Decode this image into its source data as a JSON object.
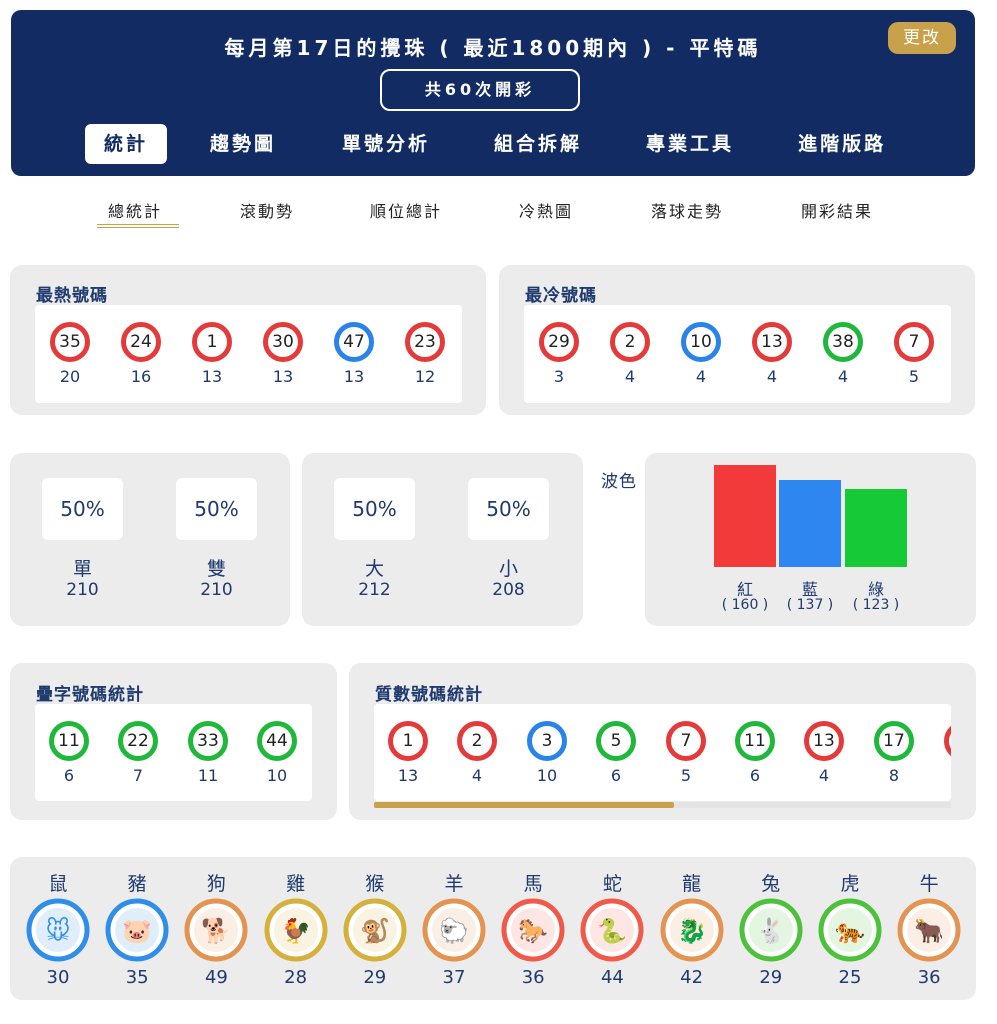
{
  "header": {
    "title": "每月第17日的攪珠 ( 最近1800期內 ) - 平特碼",
    "change_label": "更改",
    "draw_count": "共60次開彩",
    "tabs": [
      "統計",
      "趨勢圖",
      "單號分析",
      "組合拆解",
      "專業工具",
      "進階版路"
    ],
    "active_tab": "統計"
  },
  "sub_tabs": [
    "總統計",
    "滾動勢",
    "順位總計",
    "冷熱圖",
    "落球走勢",
    "開彩結果"
  ],
  "hot": {
    "title": "最熱號碼",
    "balls": [
      {
        "num": "35",
        "color": "red",
        "count": "20"
      },
      {
        "num": "24",
        "color": "red",
        "count": "16"
      },
      {
        "num": "1",
        "color": "red",
        "count": "13"
      },
      {
        "num": "30",
        "color": "red",
        "count": "13"
      },
      {
        "num": "47",
        "color": "blue",
        "count": "13"
      },
      {
        "num": "23",
        "color": "red",
        "count": "12"
      }
    ]
  },
  "cold": {
    "title": "最冷號碼",
    "balls": [
      {
        "num": "29",
        "color": "red",
        "count": "3"
      },
      {
        "num": "2",
        "color": "red",
        "count": "4"
      },
      {
        "num": "10",
        "color": "blue",
        "count": "4"
      },
      {
        "num": "13",
        "color": "red",
        "count": "4"
      },
      {
        "num": "38",
        "color": "green",
        "count": "4"
      },
      {
        "num": "7",
        "color": "red",
        "count": "5"
      }
    ]
  },
  "odd_even": {
    "odd": {
      "pct": "50%",
      "label": "單",
      "count": "210"
    },
    "even": {
      "pct": "50%",
      "label": "雙",
      "count": "210"
    }
  },
  "big_small": {
    "big": {
      "pct": "50%",
      "label": "大",
      "count": "212"
    },
    "small": {
      "pct": "50%",
      "label": "小",
      "count": "208"
    }
  },
  "wave": {
    "title": "波色",
    "colors": {
      "red": "#f23a3a",
      "blue": "#2e86f0",
      "green": "#16c936"
    }
  },
  "chart_data": {
    "type": "bar",
    "categories": [
      "紅",
      "藍",
      "綠"
    ],
    "values": [
      160,
      137,
      123
    ],
    "value_labels": [
      "( 160 )",
      "( 137 )",
      "( 123 )"
    ],
    "colors": [
      "#f23a3a",
      "#2e86f0",
      "#16c936"
    ]
  },
  "repeat": {
    "title": "疊字號碼統計",
    "balls": [
      {
        "num": "11",
        "color": "green",
        "count": "6"
      },
      {
        "num": "22",
        "color": "green",
        "count": "7"
      },
      {
        "num": "33",
        "color": "green",
        "count": "11"
      },
      {
        "num": "44",
        "color": "green",
        "count": "10"
      }
    ]
  },
  "prime": {
    "title": "質數號碼統計",
    "balls": [
      {
        "num": "1",
        "color": "red",
        "count": "13"
      },
      {
        "num": "2",
        "color": "red",
        "count": "4"
      },
      {
        "num": "3",
        "color": "blue",
        "count": "10"
      },
      {
        "num": "5",
        "color": "green",
        "count": "6"
      },
      {
        "num": "7",
        "color": "red",
        "count": "5"
      },
      {
        "num": "11",
        "color": "green",
        "count": "6"
      },
      {
        "num": "13",
        "color": "red",
        "count": "4"
      },
      {
        "num": "17",
        "color": "green",
        "count": "8"
      }
    ]
  },
  "zodiac": [
    {
      "name": "鼠",
      "count": "30",
      "icon": "rat-icon",
      "color": "#2f8fe8"
    },
    {
      "name": "豬",
      "count": "35",
      "icon": "pig-icon",
      "color": "#2f8fe8"
    },
    {
      "name": "狗",
      "count": "49",
      "icon": "dog-icon",
      "color": "#e39450"
    },
    {
      "name": "雞",
      "count": "28",
      "icon": "rooster-icon",
      "color": "#d4b13a"
    },
    {
      "name": "猴",
      "count": "29",
      "icon": "monkey-icon",
      "color": "#d4b13a"
    },
    {
      "name": "羊",
      "count": "37",
      "icon": "goat-icon",
      "color": "#e39450"
    },
    {
      "name": "馬",
      "count": "36",
      "icon": "horse-icon",
      "color": "#ef5a4a"
    },
    {
      "name": "蛇",
      "count": "44",
      "icon": "snake-icon",
      "color": "#ef5a4a"
    },
    {
      "name": "龍",
      "count": "42",
      "icon": "dragon-icon",
      "color": "#e39450"
    },
    {
      "name": "兔",
      "count": "29",
      "icon": "rabbit-icon",
      "color": "#4cc23a"
    },
    {
      "name": "虎",
      "count": "25",
      "icon": "tiger-icon",
      "color": "#4cc23a"
    },
    {
      "name": "牛",
      "count": "36",
      "icon": "ox-icon",
      "color": "#e39450"
    }
  ]
}
